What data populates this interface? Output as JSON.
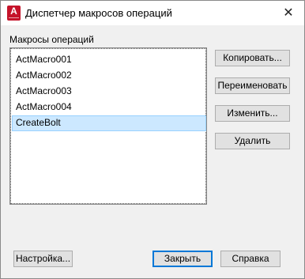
{
  "window": {
    "title": "Диспетчер макросов операций",
    "app_icon_letter": "A",
    "close_glyph": "✕",
    "accent_color": "#c5132a"
  },
  "macros": {
    "label": "Макросы операций",
    "items": [
      "ActMacro001",
      "ActMacro002",
      "ActMacro003",
      "ActMacro004",
      "CreateBolt"
    ],
    "selected": "CreateBolt"
  },
  "buttons": {
    "copy": "Копировать...",
    "rename": "Переименовать",
    "edit": "Изменить...",
    "delete": "Удалить",
    "settings": "Настройка...",
    "close": "Закрыть",
    "help": "Справка"
  }
}
